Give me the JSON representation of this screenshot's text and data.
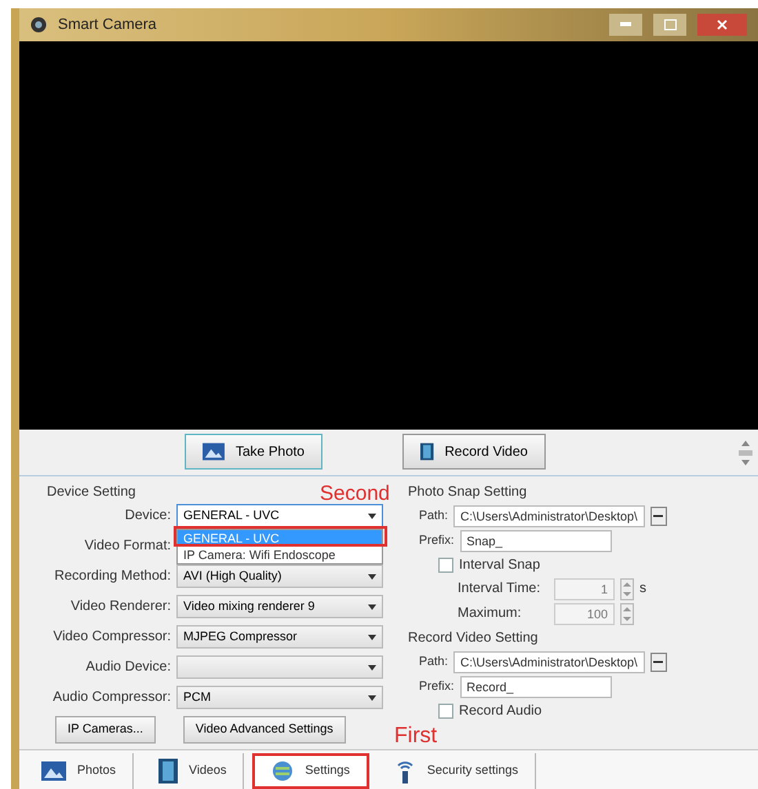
{
  "window": {
    "title": "Smart Camera"
  },
  "capture_buttons": [
    {
      "label": "Take Photo",
      "kind": "photo"
    },
    {
      "label": "Record Video",
      "kind": "video"
    }
  ],
  "device_setting": {
    "title": "Device Setting",
    "fields": [
      {
        "label": "Device:",
        "kind": "combo",
        "value": "GENERAL - UVC",
        "options": [
          {
            "label": "GENERAL - UVC",
            "selected": true
          },
          {
            "label": "IP Camera: Wifi Endoscope",
            "selected": false
          }
        ]
      },
      {
        "label": "Video Format:",
        "kind": "covered"
      },
      {
        "label": "Recording Method:",
        "kind": "combo",
        "value": "AVI (High Quality)"
      },
      {
        "label": "Video Renderer:",
        "kind": "combo",
        "value": "Video mixing renderer 9"
      },
      {
        "label": "Video Compressor:",
        "kind": "combo",
        "value": "MJPEG Compressor"
      },
      {
        "label": "Audio Device:",
        "kind": "combo"
      },
      {
        "label": "Audio Compressor:",
        "kind": "combo",
        "value": "PCM"
      }
    ],
    "buttons": [
      "IP Cameras...",
      "Video Advanced Settings"
    ]
  },
  "photo_snap_setting": {
    "title": "Photo Snap Setting",
    "path_label": "Path:",
    "path": "C:\\Users\\Administrator\\Desktop\\",
    "prefix_label": "Prefix:",
    "prefix": "Snap_",
    "interval_snap": {
      "label": "Interval Snap",
      "checked": false
    },
    "interval_time": {
      "label": "Interval Time:",
      "value": "1",
      "unit": "s",
      "disabled": true
    },
    "maximum": {
      "label": "Maximum:",
      "value": "100",
      "disabled": true
    }
  },
  "record_video_setting": {
    "title": "Record Video Setting",
    "path_label": "Path:",
    "path": "C:\\Users\\Administrator\\Desktop\\",
    "prefix_label": "Prefix:",
    "prefix": "Record_",
    "record_audio": {
      "label": "Record Audio",
      "checked": false
    }
  },
  "tabs": [
    {
      "label": "Photos",
      "kind": "photo",
      "selected": false
    },
    {
      "label": "Videos",
      "kind": "video",
      "selected": false
    },
    {
      "label": "Settings",
      "kind": "settings",
      "selected": true
    },
    {
      "label": "Security settings",
      "kind": "security",
      "selected": false
    }
  ],
  "annotations": [
    {
      "text": "Second"
    },
    {
      "text": "First"
    }
  ]
}
